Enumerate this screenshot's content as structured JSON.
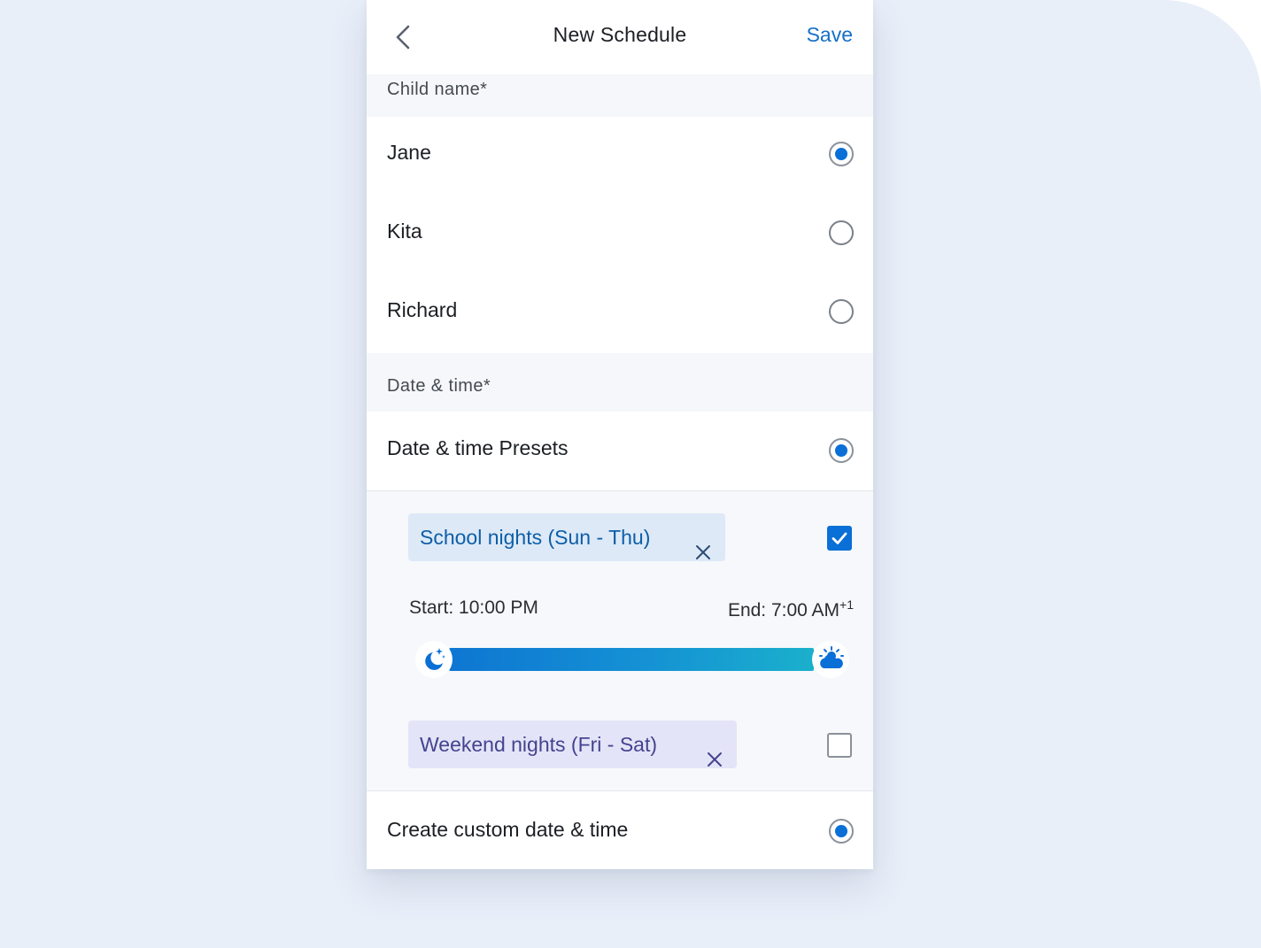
{
  "header": {
    "title": "New Schedule",
    "save_label": "Save"
  },
  "child_section": {
    "heading": "Child name*",
    "options": [
      {
        "label": "Jane",
        "selected": true
      },
      {
        "label": "Kita",
        "selected": false
      },
      {
        "label": "Richard",
        "selected": false
      }
    ]
  },
  "datetime_section": {
    "heading": "Date & time*",
    "presets_option": {
      "label": "Date & time Presets",
      "selected": true
    },
    "presets": [
      {
        "label": "School nights (Sun - Thu)",
        "checked": true,
        "start": "Start: 10:00 PM",
        "end": "End: 7:00 AM",
        "end_suffix": "+1"
      },
      {
        "label": "Weekend nights (Fri - Sat)",
        "checked": false
      }
    ],
    "custom_option": {
      "label": "Create custom date & time",
      "selected": true
    }
  },
  "icons": {
    "back": "chevron-left-icon",
    "remove": "close-icon",
    "slider_start": "moon-stars-icon",
    "slider_end": "sun-cloud-icon",
    "check": "checkmark-icon"
  },
  "colors": {
    "accent": "#0a6fd6",
    "save_link": "#1670c6",
    "school_chip_bg": "#dde9f7",
    "weekend_chip_bg": "#e4e4f8",
    "page_bg": "#e9eff9"
  }
}
